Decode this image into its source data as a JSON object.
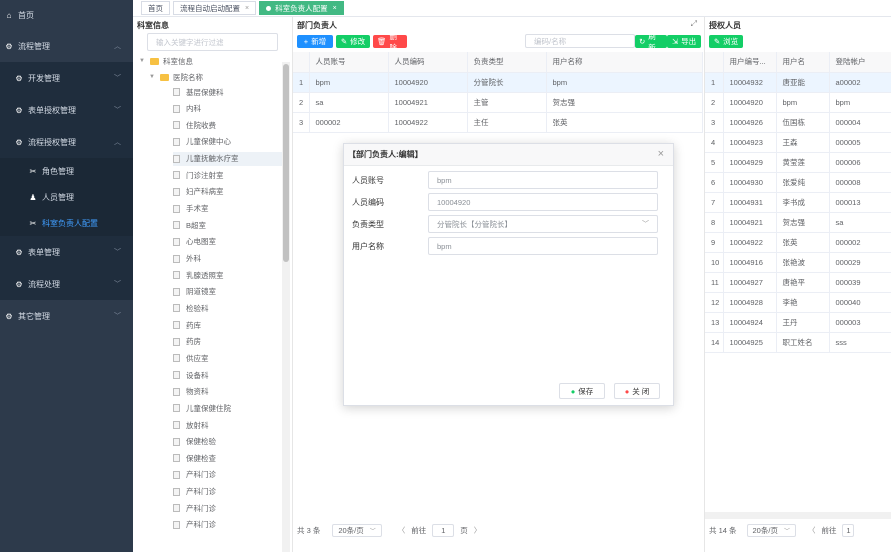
{
  "sidebar": {
    "home": "首页",
    "process_mgmt": "流程管理",
    "dev_mgmt": "开发管理",
    "form_auth": "表单授权管理",
    "process_auth": "流程授权管理",
    "role_mgmt": "角色管理",
    "person_mgmt": "人员管理",
    "dept_head_config": "科室负责人配置",
    "form_mgmt": "表单管理",
    "process_handle": "流程处理",
    "other_mgmt": "其它管理"
  },
  "tabs": [
    {
      "label": "首页"
    },
    {
      "label": "流程自动启动配置"
    },
    {
      "label": "科室负责人配置"
    }
  ],
  "tree": {
    "title": "科室信息",
    "filter_placeholder": "输入关键字进行过滤",
    "root": "科室信息",
    "group": "医院名称",
    "items": [
      "基层保健科",
      "内科",
      "住院收费",
      "儿童保健中心",
      "儿童抚触水疗室",
      "门诊注射室",
      "妇产科病室",
      "手术室",
      "B超室",
      "心电图室",
      "外科",
      "乳腺透照室",
      "阴道镜室",
      "检验科",
      "药库",
      "药房",
      "供应室",
      "设备科",
      "物资科",
      "儿童保健住院",
      "放射科",
      "保健检验",
      "保健检查",
      "产科门诊",
      "产科门诊",
      "产科门诊",
      "产科门诊"
    ]
  },
  "mid": {
    "title": "部门负责人",
    "btn_add": "新增",
    "btn_edit": "修改",
    "btn_delete": "删除",
    "search_placeholder": "编码/名称",
    "btn_refresh": "刷新",
    "btn_export": "导出",
    "columns": [
      "人员账号",
      "人员编码",
      "负责类型",
      "用户名称"
    ],
    "rows": [
      {
        "no": "1",
        "account": "bpm",
        "code": "10004920",
        "type": "分管院长",
        "name": "bpm"
      },
      {
        "no": "2",
        "account": "sa",
        "code": "10004921",
        "type": "主管",
        "name": "贺志强"
      },
      {
        "no": "3",
        "account": "000002",
        "code": "10004922",
        "type": "主任",
        "name": "张英"
      }
    ],
    "pager": {
      "total": "共 3 条",
      "size": "20条/页",
      "prev": "〈",
      "goto": "前往",
      "page": "1",
      "unit": "页",
      "next": "〉"
    }
  },
  "right": {
    "title": "授权人员",
    "btn_browse": "浏览",
    "columns": [
      "用户编号...",
      "用户名",
      "登陆帐户"
    ],
    "rows": [
      {
        "no": "1",
        "code": "10004932",
        "name": "唐亚能",
        "acct": "a00002"
      },
      {
        "no": "2",
        "code": "10004920",
        "name": "bpm",
        "acct": "bpm"
      },
      {
        "no": "3",
        "code": "10004926",
        "name": "伍国栋",
        "acct": "000004"
      },
      {
        "no": "4",
        "code": "10004923",
        "name": "王森",
        "acct": "000005"
      },
      {
        "no": "5",
        "code": "10004929",
        "name": "黄莹莲",
        "acct": "000006"
      },
      {
        "no": "6",
        "code": "10004930",
        "name": "张爱纯",
        "acct": "000008"
      },
      {
        "no": "7",
        "code": "10004931",
        "name": "李书成",
        "acct": "000013"
      },
      {
        "no": "8",
        "code": "10004921",
        "name": "贺志强",
        "acct": "sa"
      },
      {
        "no": "9",
        "code": "10004922",
        "name": "张英",
        "acct": "000002"
      },
      {
        "no": "10",
        "code": "10004916",
        "name": "张艳波",
        "acct": "000029"
      },
      {
        "no": "11",
        "code": "10004927",
        "name": "唐艳平",
        "acct": "000039"
      },
      {
        "no": "12",
        "code": "10004928",
        "name": "李艳",
        "acct": "000040"
      },
      {
        "no": "13",
        "code": "10004924",
        "name": "王丹",
        "acct": "000003"
      },
      {
        "no": "14",
        "code": "10004925",
        "name": "职工姓名",
        "acct": "sss"
      }
    ],
    "pager": {
      "total": "共 14 条",
      "size": "20条/页",
      "prev": "〈",
      "goto": "前往",
      "page": "1"
    }
  },
  "modal": {
    "title": "【部门负责人:编辑】",
    "fields": [
      {
        "label": "人员账号",
        "value": "bpm"
      },
      {
        "label": "人员编码",
        "value": "10004920"
      },
      {
        "label": "负责类型",
        "value": "分管院长【分管院长】"
      },
      {
        "label": "用户名称",
        "value": "bpm"
      }
    ],
    "btn_save": "保存",
    "btn_close": "关 闭"
  },
  "colors": {
    "sidebar_bg": "#2d3a4b",
    "active_tab": "#42b983",
    "btn_blue": "#1e90ff",
    "btn_green": "#13ce66",
    "btn_red": "#ff4949",
    "link_active": "#409eff"
  }
}
